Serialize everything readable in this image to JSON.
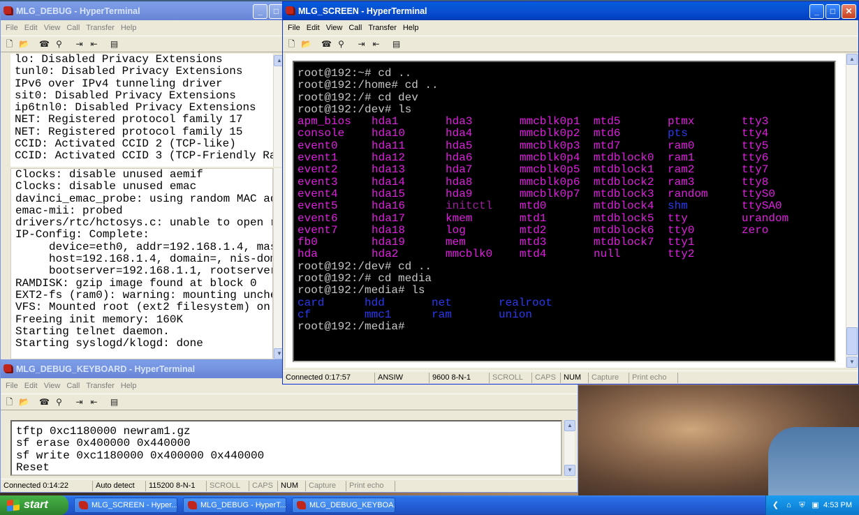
{
  "windows": {
    "debug": {
      "title": "MLG_DEBUG - HyperTerminal",
      "upper_lines": [
        "lo: Disabled Privacy Extensions",
        "tunl0: Disabled Privacy Extensions",
        "IPv6 over IPv4 tunneling driver",
        "sit0: Disabled Privacy Extensions",
        "ip6tnl0: Disabled Privacy Extensions",
        "NET: Registered protocol family 17",
        "NET: Registered protocol family 15",
        "CCID: Activated CCID 2 (TCP-like)",
        "CCID: Activated CCID 3 (TCP-Friendly Ra"
      ],
      "lower_lines": [
        "Clocks: disable unused aemif",
        "Clocks: disable unused emac",
        "davinci_emac_probe: using random MAC ad",
        "emac-mii: probed",
        "drivers/rtc/hctosys.c: unable to open r",
        "IP-Config: Complete:",
        "     device=eth0, addr=192.168.1.4, mas",
        "     host=192.168.1.4, domain=, nis-dom",
        "     bootserver=192.168.1.1, rootserver",
        "RAMDISK: gzip image found at block 0",
        "EXT2-fs (ram0): warning: mounting unche",
        "VFS: Mounted root (ext2 filesystem) on",
        "Freeing init memory: 160K",
        "Starting telnet daemon.",
        "Starting syslogd/klogd: done"
      ]
    },
    "screen": {
      "title": "MLG_SCREEN - HyperTerminal",
      "prompt_lines_top": [
        "root@192:~# cd ..",
        "root@192:/home# cd ..",
        "root@192:/# cd dev",
        "root@192:/dev# ls"
      ],
      "ls_dev_rows": [
        [
          "apm_bios",
          "hda1",
          "hda3",
          "mmcblk0p1",
          "mtd5",
          "ptmx",
          "tty3"
        ],
        [
          "console",
          "hda10",
          "hda4",
          "mmcblk0p2",
          "mtd6",
          "pts",
          "tty4"
        ],
        [
          "event0",
          "hda11",
          "hda5",
          "mmcblk0p3",
          "mtd7",
          "ram0",
          "tty5"
        ],
        [
          "event1",
          "hda12",
          "hda6",
          "mmcblk0p4",
          "mtdblock0",
          "ram1",
          "tty6"
        ],
        [
          "event2",
          "hda13",
          "hda7",
          "mmcblk0p5",
          "mtdblock1",
          "ram2",
          "tty7"
        ],
        [
          "event3",
          "hda14",
          "hda8",
          "mmcblk0p6",
          "mtdblock2",
          "ram3",
          "tty8"
        ],
        [
          "event4",
          "hda15",
          "hda9",
          "mmcblk0p7",
          "mtdblock3",
          "random",
          "ttyS0"
        ],
        [
          "event5",
          "hda16",
          "initctl",
          "mtd0",
          "mtdblock4",
          "shm",
          "ttySA0"
        ],
        [
          "event6",
          "hda17",
          "kmem",
          "mtd1",
          "mtdblock5",
          "tty",
          "urandom"
        ],
        [
          "event7",
          "hda18",
          "log",
          "mtd2",
          "mtdblock6",
          "tty0",
          "zero"
        ],
        [
          "fb0",
          "hda19",
          "mem",
          "mtd3",
          "mtdblock7",
          "tty1",
          ""
        ],
        [
          "hda",
          "hda2",
          "mmcblk0",
          "mtd4",
          "null",
          "tty2",
          ""
        ]
      ],
      "prompt_lines_mid": [
        "root@192:/dev# cd ..",
        "root@192:/# cd media",
        "root@192:/media# ls"
      ],
      "ls_media_rows": [
        [
          "card",
          "hdd",
          "net",
          "realroot"
        ],
        [
          "cf",
          "mmc1",
          "ram",
          "union"
        ]
      ],
      "prompt_last": "root@192:/media#",
      "status": {
        "connected": "Connected 0:17:57",
        "emulation": "ANSIW",
        "port": "9600 8-N-1",
        "scroll": "SCROLL",
        "caps": "CAPS",
        "num": "NUM",
        "capture": "Capture",
        "print_echo": "Print echo"
      }
    },
    "keyboard": {
      "title": "MLG_DEBUG_KEYBOARD - HyperTerminal",
      "lines": [
        "tftp 0xc1180000 newram1.gz",
        "sf erase 0x400000 0x440000",
        "sf write 0xc1180000 0x400000 0x440000",
        "Reset"
      ],
      "status": {
        "connected": "Connected 0:14:22",
        "emulation": "Auto detect",
        "port": "115200 8-N-1",
        "scroll": "SCROLL",
        "caps": "CAPS",
        "num": "NUM",
        "capture": "Capture",
        "print_echo": "Print echo"
      }
    }
  },
  "menu": [
    "File",
    "Edit",
    "View",
    "Call",
    "Transfer",
    "Help"
  ],
  "taskbar": {
    "start_label": "start",
    "items": [
      "MLG_SCREEN - Hyper...",
      "MLG_DEBUG - HyperT...",
      "MLG_DEBUG_KEYBOA..."
    ],
    "clock": "4:53 PM"
  },
  "colors": {
    "title_active": "#0a4fd0",
    "terminal_bg": "#000000",
    "terminal_fg": "#c6c6c6",
    "ls_magenta": "#e01ee0",
    "ls_blue": "#2b39f0"
  }
}
